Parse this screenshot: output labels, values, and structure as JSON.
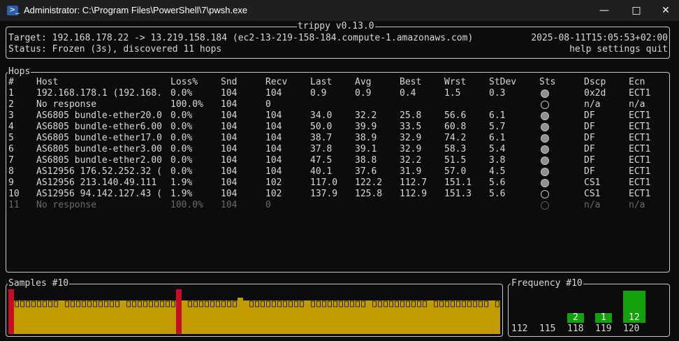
{
  "window": {
    "title": "Administrator: C:\\Program Files\\PowerShell\\7\\pwsh.exe",
    "icon": "powershell-icon"
  },
  "app": {
    "title": "trippy v0.13.0",
    "target": "Target: 192.168.178.22 -> 13.219.158.184 (ec2-13-219-158-184.compute-1.amazonaws.com)",
    "status": "Status: Frozen (3s), discovered 11 hops",
    "timestamp": "2025-08-11T15:05:53+02:00",
    "menu": "help settings quit"
  },
  "hops": {
    "title": "Hops",
    "columns": [
      "#",
      "Host",
      "Loss%",
      "Snd",
      "Recv",
      "Last",
      "Avg",
      "Best",
      "Wrst",
      "StDev",
      "Sts",
      "Dscp",
      "Ecn"
    ],
    "rows": [
      {
        "n": "1",
        "host": "192.168.178.1 (192.168.",
        "loss": "0.0%",
        "snd": "104",
        "recv": "104",
        "last": "0.9",
        "avg": "0.9",
        "best": "0.4",
        "wrst": "1.5",
        "stdev": "0.3",
        "sts": "filled",
        "dscp": "0x2d",
        "ecn": "ECT1",
        "dim": false
      },
      {
        "n": "2",
        "host": "No response",
        "loss": "100.0%",
        "snd": "104",
        "recv": "0",
        "last": "",
        "avg": "",
        "best": "",
        "wrst": "",
        "stdev": "",
        "sts": "empty",
        "dscp": "n/a",
        "ecn": "n/a",
        "dim": false
      },
      {
        "n": "3",
        "host": "AS6805 bundle-ether20.0",
        "loss": "0.0%",
        "snd": "104",
        "recv": "104",
        "last": "34.0",
        "avg": "32.2",
        "best": "25.8",
        "wrst": "56.6",
        "stdev": "6.1",
        "sts": "filled",
        "dscp": "DF",
        "ecn": "ECT1",
        "dim": false
      },
      {
        "n": "4",
        "host": "AS6805 bundle-ether6.00",
        "loss": "0.0%",
        "snd": "104",
        "recv": "104",
        "last": "50.0",
        "avg": "39.9",
        "best": "33.5",
        "wrst": "60.8",
        "stdev": "5.7",
        "sts": "filled",
        "dscp": "DF",
        "ecn": "ECT1",
        "dim": false
      },
      {
        "n": "5",
        "host": "AS6805 bundle-ether17.0",
        "loss": "0.0%",
        "snd": "104",
        "recv": "104",
        "last": "38.7",
        "avg": "38.9",
        "best": "32.9",
        "wrst": "74.2",
        "stdev": "6.1",
        "sts": "filled",
        "dscp": "DF",
        "ecn": "ECT1",
        "dim": false
      },
      {
        "n": "6",
        "host": "AS6805 bundle-ether3.00",
        "loss": "0.0%",
        "snd": "104",
        "recv": "104",
        "last": "37.8",
        "avg": "39.1",
        "best": "32.9",
        "wrst": "58.3",
        "stdev": "5.4",
        "sts": "filled",
        "dscp": "DF",
        "ecn": "ECT1",
        "dim": false
      },
      {
        "n": "7",
        "host": "AS6805 bundle-ether2.00",
        "loss": "0.0%",
        "snd": "104",
        "recv": "104",
        "last": "47.5",
        "avg": "38.8",
        "best": "32.2",
        "wrst": "51.5",
        "stdev": "3.8",
        "sts": "filled",
        "dscp": "DF",
        "ecn": "ECT1",
        "dim": false
      },
      {
        "n": "8",
        "host": "AS12956 176.52.252.32 (",
        "loss": "0.0%",
        "snd": "104",
        "recv": "104",
        "last": "40.1",
        "avg": "37.6",
        "best": "31.9",
        "wrst": "57.0",
        "stdev": "4.5",
        "sts": "filled",
        "dscp": "DF",
        "ecn": "ECT1",
        "dim": false
      },
      {
        "n": "9",
        "host": "AS12956 213.140.49.111",
        "loss": "1.9%",
        "snd": "104",
        "recv": "102",
        "last": "117.0",
        "avg": "122.2",
        "best": "112.7",
        "wrst": "151.1",
        "stdev": "5.6",
        "sts": "filled",
        "dscp": "CS1",
        "ecn": "ECT1",
        "dim": false
      },
      {
        "n": "10",
        "host": "AS12956 94.142.127.43 (",
        "loss": "1.9%",
        "snd": "104",
        "recv": "102",
        "last": "137.9",
        "avg": "125.8",
        "best": "112.9",
        "wrst": "151.3",
        "stdev": "5.6",
        "sts": "empty",
        "dscp": "CS1",
        "ecn": "ECT1",
        "dim": false
      },
      {
        "n": "11",
        "host": "No response",
        "loss": "100.0%",
        "snd": "104",
        "recv": "0",
        "last": "",
        "avg": "",
        "best": "",
        "wrst": "",
        "stdev": "",
        "sts": "empty",
        "dscp": "n/a",
        "ecn": "n/a",
        "dim": true
      }
    ]
  },
  "samples": {
    "title": "Samples #10",
    "colors": {
      "bar": "#c19c00",
      "loss": "#c50f1f",
      "ticks": "#0c0c0c"
    }
  },
  "frequency": {
    "title": "Frequency #10",
    "bins": [
      {
        "label": "112",
        "count": "",
        "value": 0
      },
      {
        "label": "115",
        "count": "",
        "value": 0
      },
      {
        "label": "118",
        "count": "2",
        "value": 2
      },
      {
        "label": "119",
        "count": "1",
        "value": 1
      },
      {
        "label": "120",
        "count": "12",
        "value": 12
      }
    ],
    "color": "#13a10e"
  }
}
